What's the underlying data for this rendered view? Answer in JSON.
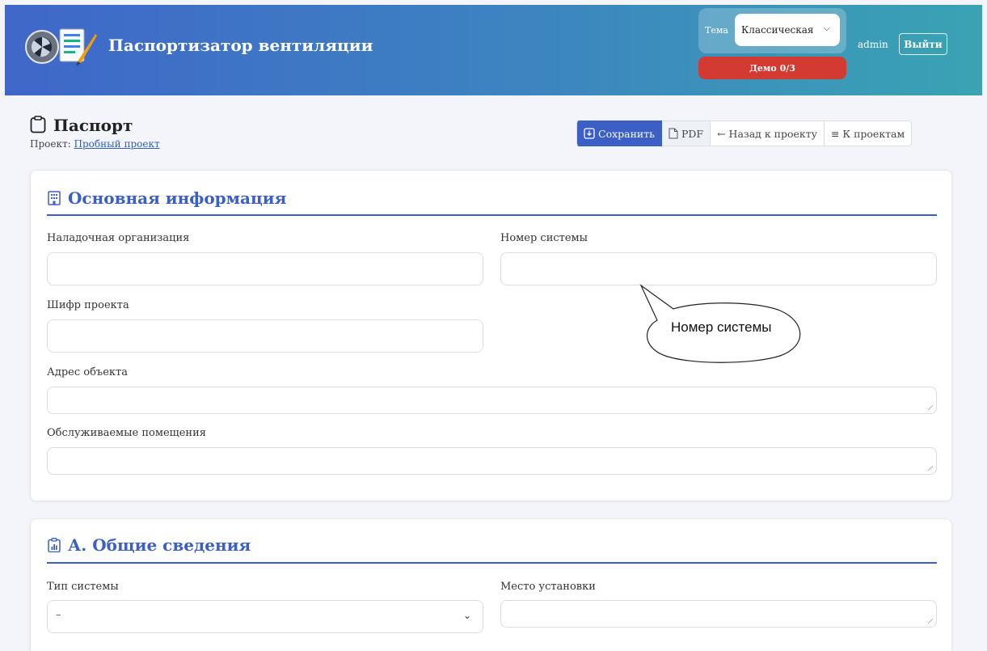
{
  "header": {
    "app_title": "Паспортизатор вентиляции",
    "theme_label": "Тема",
    "theme_value": "Классическая",
    "demo_badge": "Демо 0/3",
    "user": "admin",
    "logout_label": "Выйти"
  },
  "page": {
    "title": "Паспорт",
    "project_prefix": "Проект:",
    "project_link": "Пробный проект"
  },
  "toolbar": {
    "save_label": "Сохранить",
    "pdf_label": "PDF",
    "back_label": "← Назад к проекту",
    "projects_label": "≡ К проектам"
  },
  "basic_info": {
    "title": "Основная информация",
    "fields": {
      "org_label": "Наладочная организация",
      "system_number_label": "Номер системы",
      "cipher_label": "Шифр проекта",
      "address_label": "Адрес объекта",
      "rooms_label": "Обслуживаемые помещения"
    }
  },
  "general": {
    "title": "А. Общие сведения",
    "system_type_label": "Тип системы",
    "system_type_value": "–",
    "location_label": "Место установки"
  },
  "callout": {
    "text": "Номер системы"
  },
  "colors": {
    "accent": "#3b5fc5",
    "demo": "#d33a32"
  }
}
